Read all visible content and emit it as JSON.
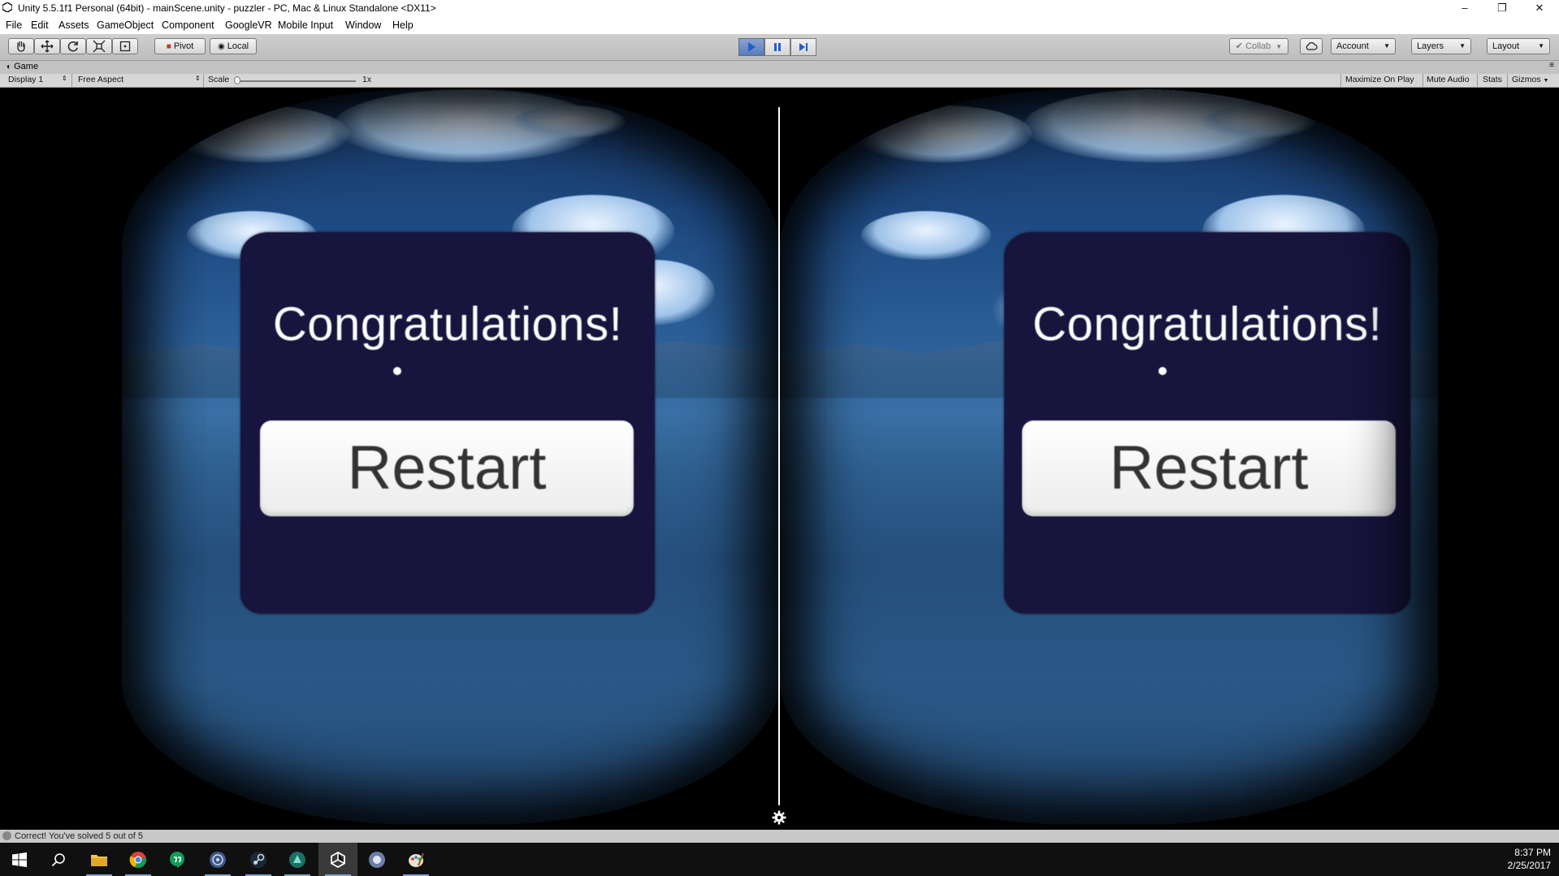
{
  "window": {
    "title": "Unity 5.5.1f1 Personal (64bit) - mainScene.unity - puzzler - PC, Mac & Linux Standalone <DX11>",
    "minimize": "–",
    "maximize": "❐",
    "close": "✕"
  },
  "menu": [
    "File",
    "Edit",
    "Assets",
    "GameObject",
    "Component",
    "GoogleVR",
    "Mobile Input",
    "Window",
    "Help"
  ],
  "toolbar": {
    "pivot": "Pivot",
    "local": "Local",
    "collab": "Collab",
    "account": "Account",
    "layers": "Layers",
    "layout": "Layout"
  },
  "game_view": {
    "tab": "Game",
    "display": "Display 1",
    "aspect": "Free Aspect",
    "scale_label": "Scale",
    "scale_value": "1x",
    "maximize_on_play": "Maximize On Play",
    "mute_audio": "Mute Audio",
    "stats": "Stats",
    "gizmos": "Gizmos"
  },
  "scene": {
    "left_eye": {
      "title": "Congratulations!",
      "button": "Restart"
    },
    "right_eye": {
      "title": "Congratulations!",
      "button": "Restart"
    }
  },
  "status": {
    "message": "Correct!  You've solved 5 out of 5"
  },
  "taskbar": {
    "time": "8:37 PM",
    "date": "2/25/2017",
    "apps": [
      "start-icon",
      "search-icon",
      "file-explorer-icon",
      "chrome-icon",
      "hangouts-icon",
      "unity-hub-icon",
      "steam-icon",
      "app-icon",
      "unity-icon",
      "app-icon",
      "paint-icon"
    ]
  },
  "colors": {
    "panel": "#17143d",
    "play_active": "#5a7bb8",
    "sky": "#2c5f98"
  }
}
